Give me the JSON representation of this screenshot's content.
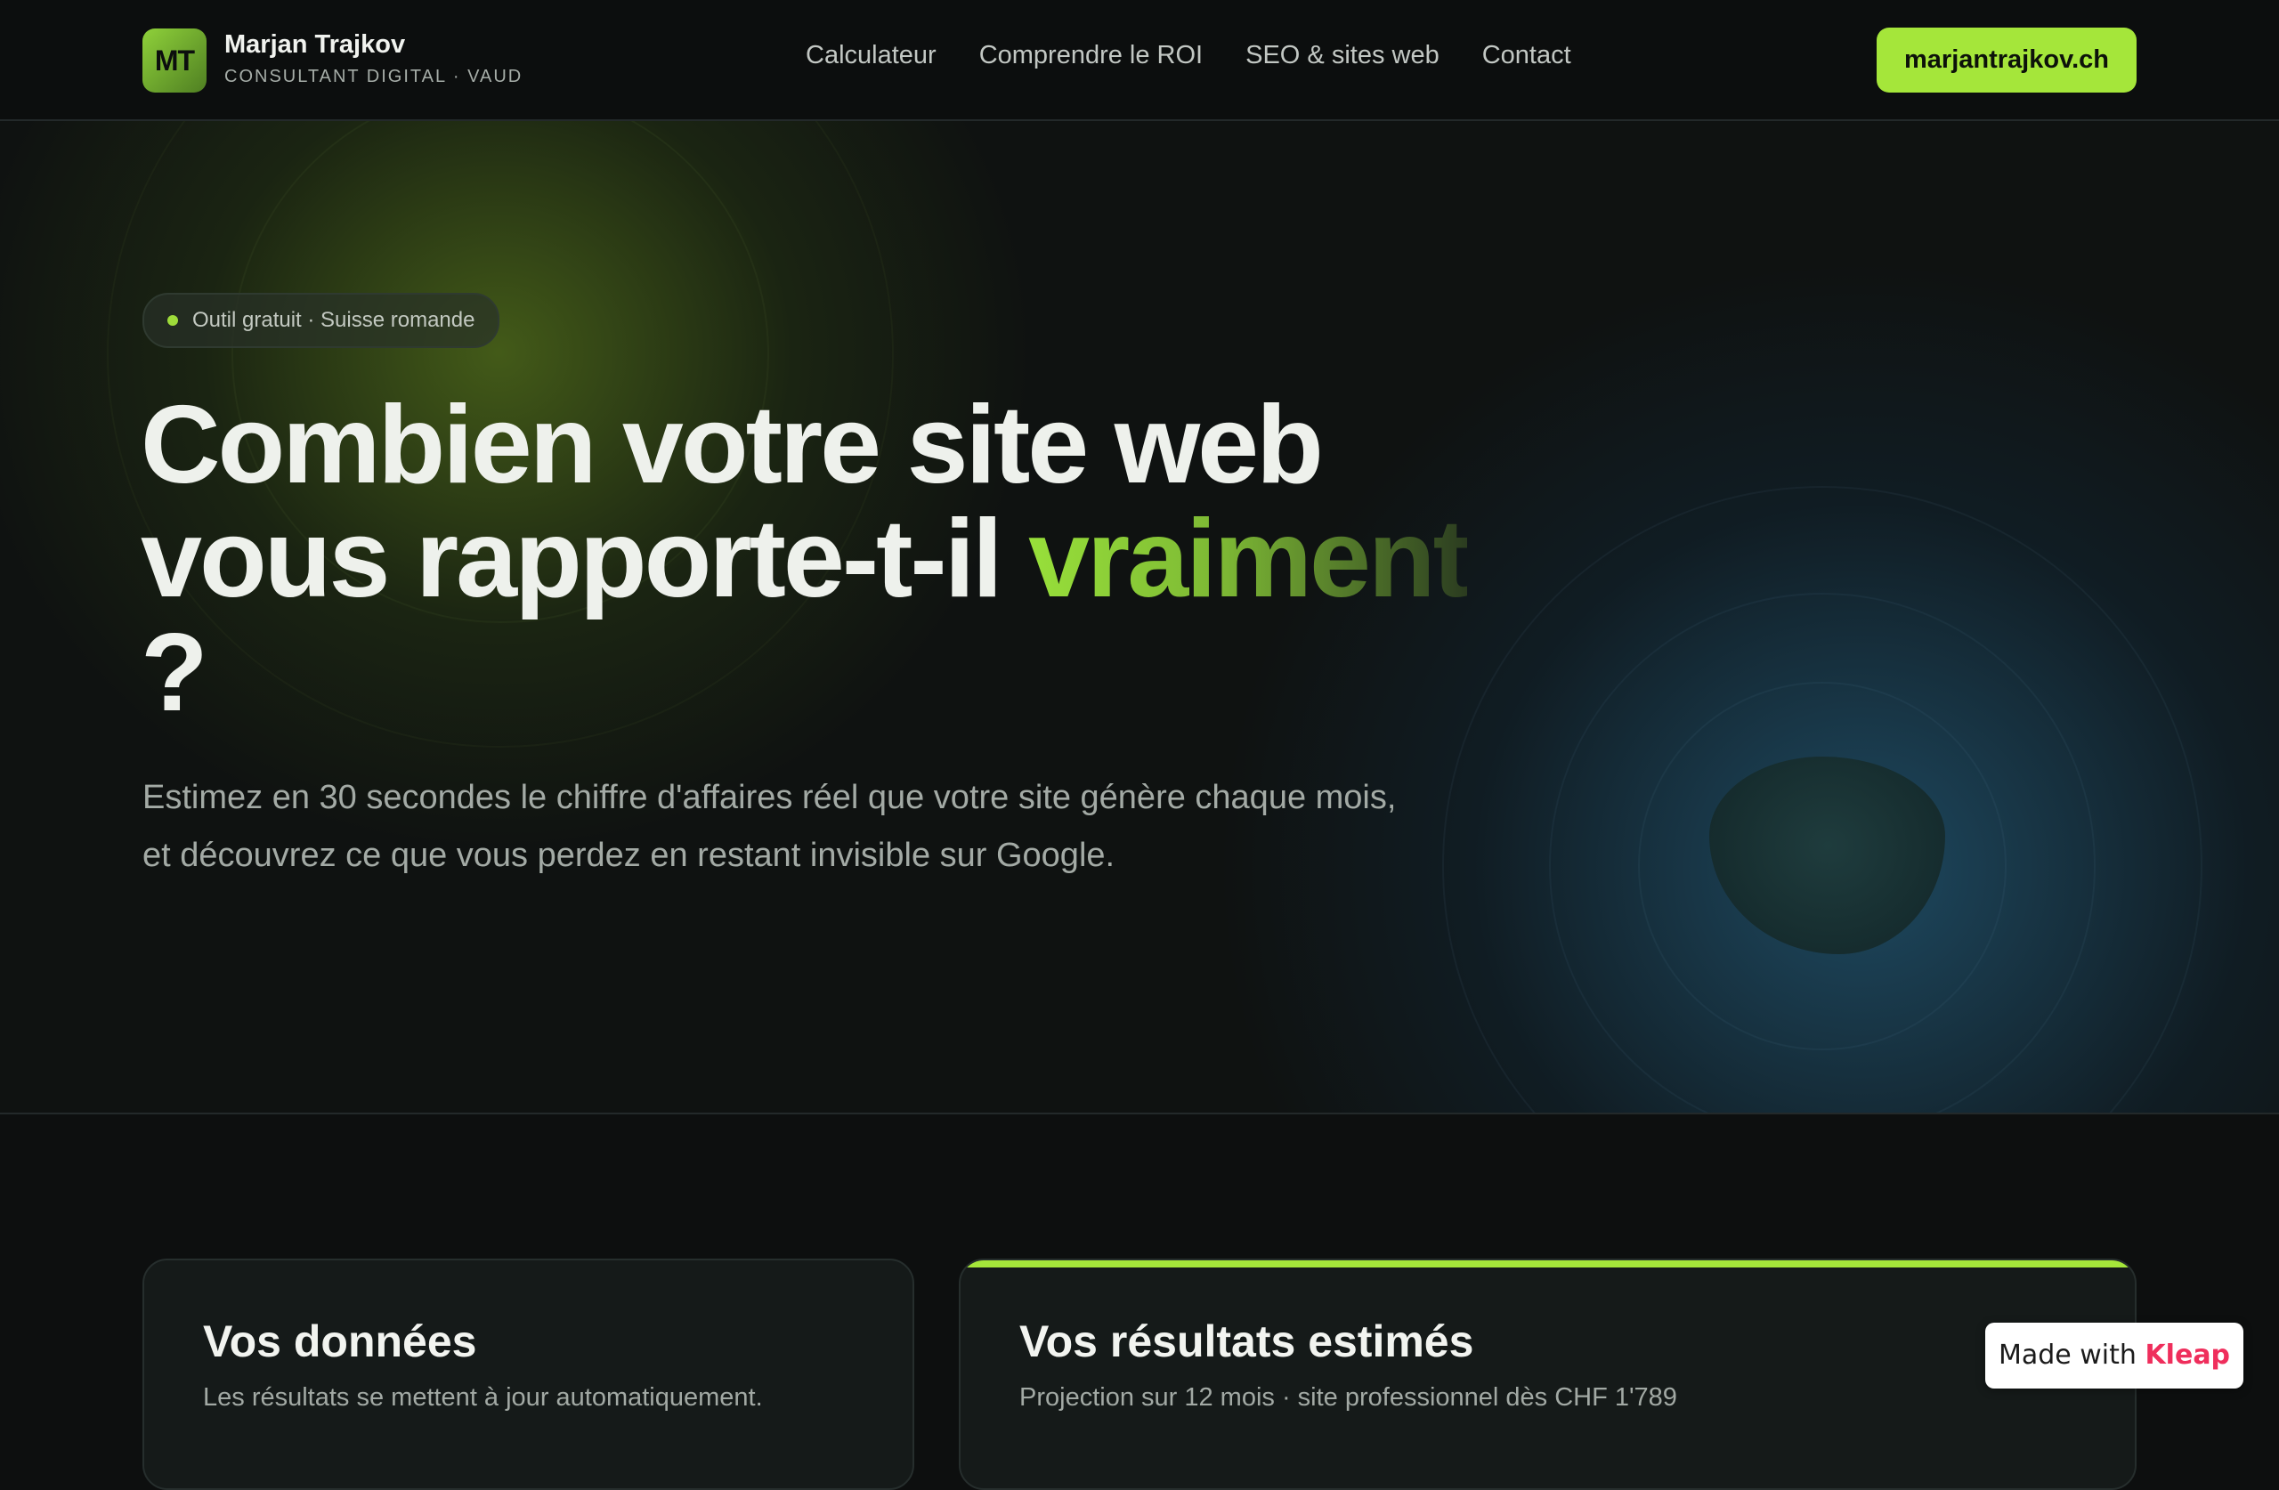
{
  "header": {
    "logo_initials": "MT",
    "brand_name": "Marjan Trajkov",
    "brand_tagline": "CONSULTANT DIGITAL · VAUD",
    "nav": [
      {
        "label": "Calculateur"
      },
      {
        "label": "Comprendre le ROI"
      },
      {
        "label": "SEO & sites web"
      },
      {
        "label": "Contact"
      }
    ],
    "cta_label": "marjantrajkov.ch"
  },
  "hero": {
    "badge": "Outil gratuit · Suisse romande",
    "headline_part1": "Combien votre site web vous rapporte-t-il ",
    "headline_accent": "vraiment",
    "headline_end": " ?",
    "lead": "Estimez en 30 secondes le chiffre d'affaires réel que votre site génère chaque mois, et découvrez ce que vous perdez en restant invisible sur Google."
  },
  "cards": {
    "data": {
      "title": "Vos données",
      "subtitle": "Les résultats se mettent à jour automatiquement."
    },
    "results": {
      "title": "Vos résultats estimés",
      "subtitle": "Projection sur 12 mois · site professionnel dès CHF 1'789"
    }
  },
  "made_with": {
    "prefix": "Made with ",
    "brand": "Kleap"
  },
  "colors": {
    "accent": "#a5e63a",
    "background": "#0d0f0f",
    "kleap": "#ef2e5c"
  }
}
